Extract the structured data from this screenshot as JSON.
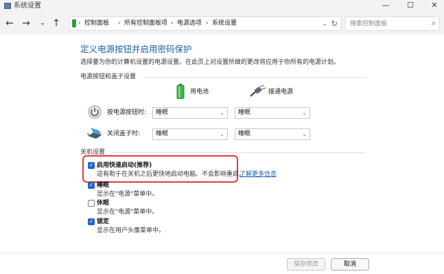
{
  "window": {
    "title": "系统设置",
    "minimize": "—",
    "maximize": "☐",
    "close": "✕"
  },
  "nav": {
    "back": "←",
    "forward": "→",
    "dropdown": "⌄",
    "up": "↑",
    "breadcrumbs": [
      "控制面板",
      "所有控制面板项",
      "电源选项",
      "系统设置"
    ],
    "separator": "›",
    "address_dropdown": "⌄",
    "refresh": "↻",
    "search_placeholder": "搜索控制面板",
    "search_icon": "⌕"
  },
  "main": {
    "heading": "定义电源按钮并启用密码保护",
    "subheading": "选择要为你的计算机设置的电源设置。在此页上对设置所做的更改将应用于你所有的电源计划。",
    "power_section": {
      "title": "电源按钮和盖子设置",
      "col_battery": "用电池",
      "col_plugged": "接通电源",
      "rows": [
        {
          "label": "按电源按钮时:",
          "battery": "睡眠",
          "plugged": "睡眠",
          "icon": "power-button-icon"
        },
        {
          "label": "关闭盖子时:",
          "battery": "睡眠",
          "plugged": "睡眠",
          "icon": "laptop-lid-icon"
        }
      ]
    },
    "shutdown_section": {
      "title": "关机设置",
      "options": [
        {
          "title": "启用快速启动(推荐)",
          "desc": "这有助于在关机之后更快地启动电脑。不会影响重启。",
          "checked": true
        },
        {
          "title": "睡眠",
          "desc": "显示在\"电源\"菜单中。",
          "checked": true
        },
        {
          "title": "休眠",
          "desc": "显示在\"电源\"菜单中。",
          "checked": false
        },
        {
          "title": "锁定",
          "desc": "显示在用户头像菜单中。",
          "checked": true
        }
      ],
      "learn_more": "了解更多信息"
    }
  },
  "footer": {
    "save": "保存修改",
    "cancel": "取消"
  },
  "colors": {
    "accent": "#1e5fa8",
    "checkbox": "#2466c6",
    "highlight": "#e03a3a"
  }
}
